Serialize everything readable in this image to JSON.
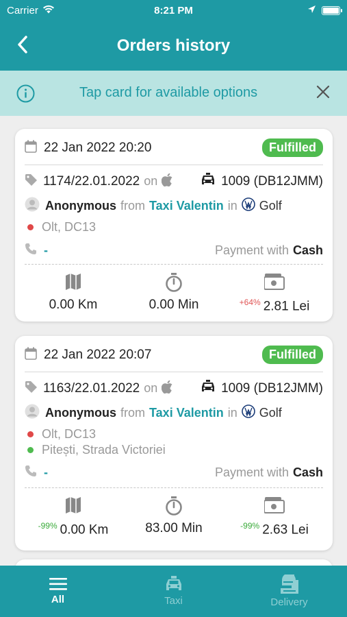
{
  "status_bar": {
    "carrier": "Carrier",
    "time": "8:21 PM"
  },
  "header": {
    "title": "Orders history"
  },
  "banner": {
    "text": "Tap card for available options"
  },
  "orders": [
    {
      "date": "22 Jan 2022 20:20",
      "status": "Fulfilled",
      "order_id": "1174/22.01.2022",
      "on": "on",
      "car": "1009 (DB12JMM)",
      "customer": "Anonymous",
      "from_word": "from",
      "company": "Taxi Valentin",
      "in_word": "in",
      "vehicle": "Golf",
      "pickup": "Olt, DC13",
      "phone": "-",
      "payment_prefix": "Payment with",
      "payment_method": "Cash",
      "distance": "0.00 Km",
      "distance_pct": "",
      "duration": "0.00 Min",
      "price_pct": "+64%",
      "price": "2.81 Lei"
    },
    {
      "date": "22 Jan 2022 20:07",
      "status": "Fulfilled",
      "order_id": "1163/22.01.2022",
      "on": "on",
      "car": "1009 (DB12JMM)",
      "customer": "Anonymous",
      "from_word": "from",
      "company": "Taxi Valentin",
      "in_word": "in",
      "vehicle": "Golf",
      "pickup": "Olt, DC13",
      "dropoff": "Pitești, Strada Victoriei",
      "phone": "-",
      "payment_prefix": "Payment with",
      "payment_method": "Cash",
      "distance_pct": "-99%",
      "distance": "0.00 Km",
      "duration": "83.00 Min",
      "price_pct": "-99%",
      "price": "2.63 Lei"
    }
  ],
  "tabs": [
    {
      "label": "All",
      "icon": "list-icon"
    },
    {
      "label": "Taxi",
      "icon": "taxi-icon"
    },
    {
      "label": "Delivery",
      "icon": "delivery-icon"
    }
  ],
  "colors": {
    "primary": "#1e9aa4",
    "banner": "#b9e4e2",
    "fulfilled": "#4fbb4f",
    "pickup_dot": "#e04848",
    "dropoff_dot": "#4fbb4f"
  }
}
